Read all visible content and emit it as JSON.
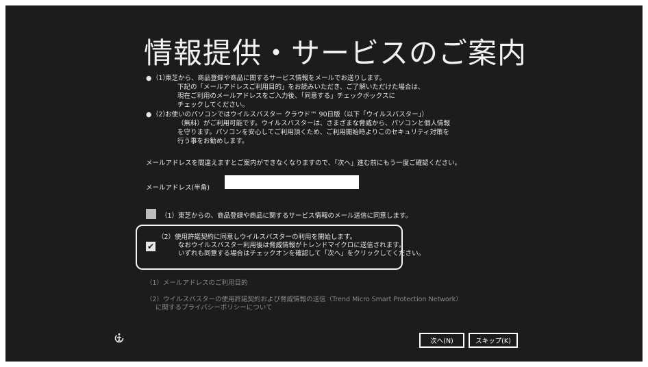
{
  "page": {
    "title": "情報提供・サービスのご案内"
  },
  "bullets": [
    {
      "marker": "●",
      "number": "（1）",
      "lines": [
        "東芝から、商品登録や商品に関するサービス情報をメールでお送りします。",
        "下記の「メールアドレスご利用目的」をお読みいただき、ご了解いただけた場合は、",
        "現在ご利用のメールアドレスをご入力後、「同意する」チェックボックスに",
        "チェックしてください。"
      ]
    },
    {
      "marker": "●",
      "number": "（2）",
      "lines": [
        "お使いのパソコンではウイルスバスター クラウド™ 90日版（以下「ウイルスバスター」）",
        "（無料）がご利用可能です。ウイルスバスターは、さまざまな脅威から、パソコンと個人情報",
        "を守ります。パソコンを安心してご利用頂くため、ご利用開始時よりこのセキュリティ対策を",
        "行う事をお勧めします。"
      ]
    }
  ],
  "notice": "メールアドレスを間違えますとご案内ができなくなりますので、「次へ」進む前にもう一度ご確認ください。",
  "email": {
    "label": "メールアドレス(半角)",
    "value": "",
    "placeholder": ""
  },
  "checkbox1": {
    "label": "（1）東芝からの、商品登録や商品に関するサービス情報のメール送信に同意します。",
    "checked": false
  },
  "checkbox2": {
    "checked": true,
    "check_glyph": "✔",
    "lines": [
      "（2）使用許諾契約に同意しウイルスバスターの利用を開始します。",
      "なおウイルスバスター利用後は脅威情報がトレンドマイクロに送信されます。",
      "いずれも同意する場合はチェックオンを確認して「次へ」をクリックしてください。"
    ]
  },
  "links": {
    "email_purpose": "（1）メールアドレスのご利用目的",
    "privacy": [
      "（2）ウイルスバスターの使用許諾契約および脅威情報の送信（Trend Micro Smart Protection Network）",
      "に関するプライバシーポリシーについて"
    ]
  },
  "buttons": {
    "next": "次へ(N)",
    "skip": "スキップ(K)"
  },
  "icons": {
    "ease_of_access": "ease-of-access-icon"
  },
  "colors": {
    "background": "#1c1c1c",
    "text": "#e8e8e8",
    "dim_text": "#8a8a8a"
  }
}
